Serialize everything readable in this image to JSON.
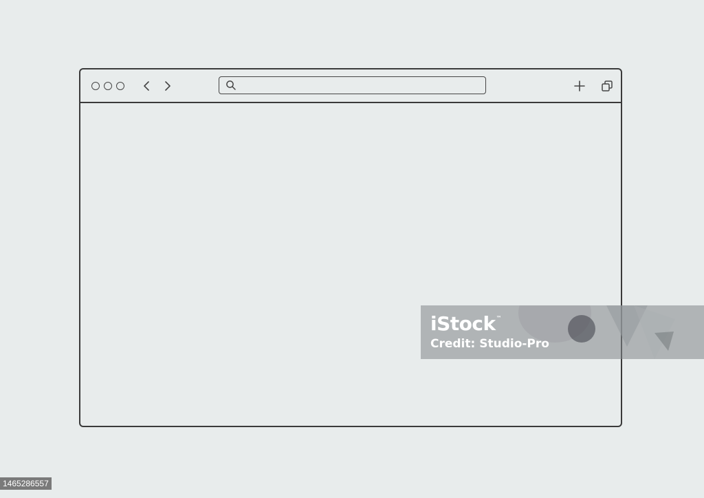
{
  "colors": {
    "background": "#e8ecec",
    "outline": "#3a3a3a"
  },
  "browser": {
    "toolbar": {
      "window_controls": [
        "circle-icon",
        "circle-icon",
        "circle-icon"
      ],
      "back_icon": "chevron-left-icon",
      "forward_icon": "chevron-right-icon",
      "address_bar": {
        "icon": "search-icon",
        "value": "",
        "placeholder": ""
      },
      "new_tab_icon": "plus-icon",
      "tabs_icon": "copy-icon"
    }
  },
  "watermark": {
    "logo": "iStock",
    "logo_mark": "™",
    "credit": "Credit: Studio-Pro"
  },
  "stock_id": "1465286557"
}
